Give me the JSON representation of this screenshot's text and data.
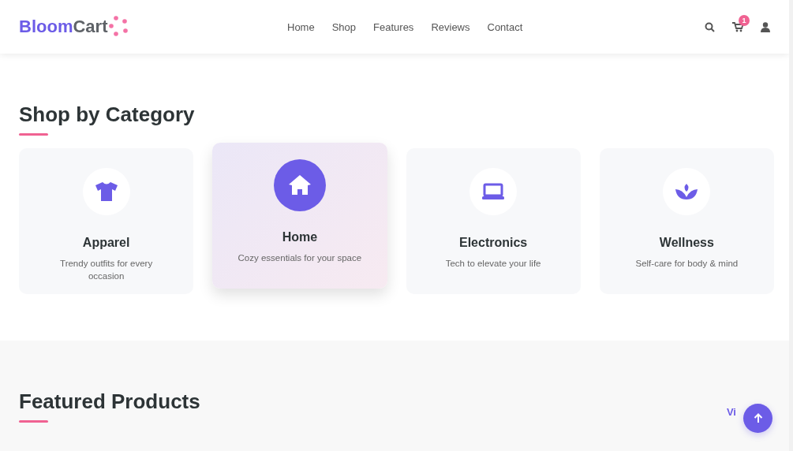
{
  "header": {
    "logo": {
      "part_1": "Bloom",
      "part_2": "Cart"
    },
    "nav": [
      {
        "label": "Home"
      },
      {
        "label": "Shop"
      },
      {
        "label": "Features"
      },
      {
        "label": "Reviews"
      },
      {
        "label": "Contact"
      }
    ],
    "cart_count": "1"
  },
  "categories_section": {
    "title": "Shop by Category",
    "cards": [
      {
        "kind": "shirt",
        "title": "Apparel",
        "text": "Trendy outfits for every occasion",
        "selected": false
      },
      {
        "kind": "house",
        "title": "Home",
        "text": "Cozy essentials for your space",
        "selected": true
      },
      {
        "kind": "laptop",
        "title": "Electronics",
        "text": "Tech to elevate your life",
        "selected": false
      },
      {
        "kind": "lotus",
        "title": "Wellness",
        "text": "Self-care for body & mind",
        "selected": false
      }
    ]
  },
  "featured_section": {
    "title": "Featured Products",
    "link": "Vi"
  }
}
